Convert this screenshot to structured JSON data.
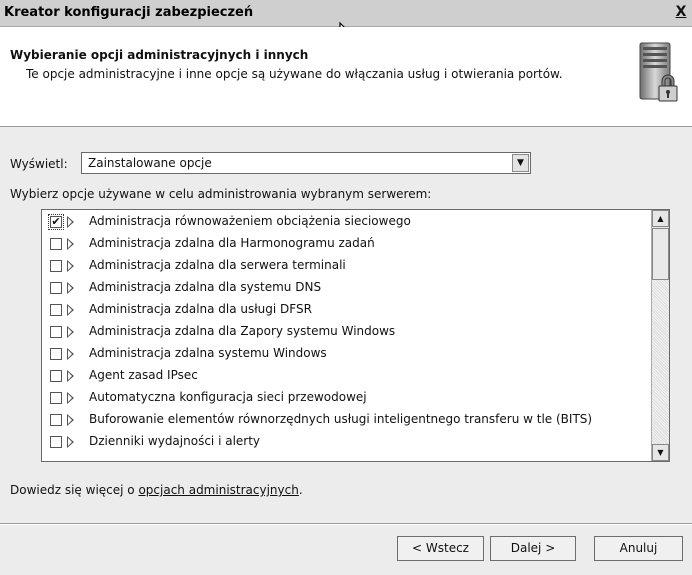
{
  "window": {
    "title": "Kreator konfiguracji zabezpieczeń",
    "close_label": "X"
  },
  "header": {
    "title": "Wybieranie opcji administracyjnych i innych",
    "subtitle": "Te opcje administracyjne i inne opcje są używane do włączania usług i otwierania portów."
  },
  "display": {
    "label": "Wyświetl:",
    "selected": "Zainstalowane opcje"
  },
  "list": {
    "prompt": "Wybierz opcje używane w celu administrowania wybranym serwerem:",
    "items": [
      {
        "label": "Administracja równoważeniem obciążenia sieciowego",
        "checked": true
      },
      {
        "label": "Administracja zdalna dla Harmonogramu zadań",
        "checked": false
      },
      {
        "label": "Administracja zdalna dla serwera terminali",
        "checked": false
      },
      {
        "label": "Administracja zdalna dla systemu DNS",
        "checked": false
      },
      {
        "label": "Administracja zdalna dla usługi DFSR",
        "checked": false
      },
      {
        "label": "Administracja zdalna dla Zapory systemu Windows",
        "checked": false
      },
      {
        "label": "Administracja zdalna systemu Windows",
        "checked": false
      },
      {
        "label": "Agent zasad IPsec",
        "checked": false
      },
      {
        "label": "Automatyczna konfiguracja sieci przewodowej",
        "checked": false
      },
      {
        "label": "Buforowanie elementów równorzędnych usługi inteligentnego transferu w tle (BITS)",
        "checked": false
      },
      {
        "label": "Dzienniki wydajności i alerty",
        "checked": false
      }
    ]
  },
  "learn_more": {
    "prefix": "Dowiedz się więcej o ",
    "link": "opcjach administracyjnych",
    "suffix": "."
  },
  "buttons": {
    "back": "< Wstecz",
    "next": "Dalej >",
    "cancel": "Anuluj"
  }
}
